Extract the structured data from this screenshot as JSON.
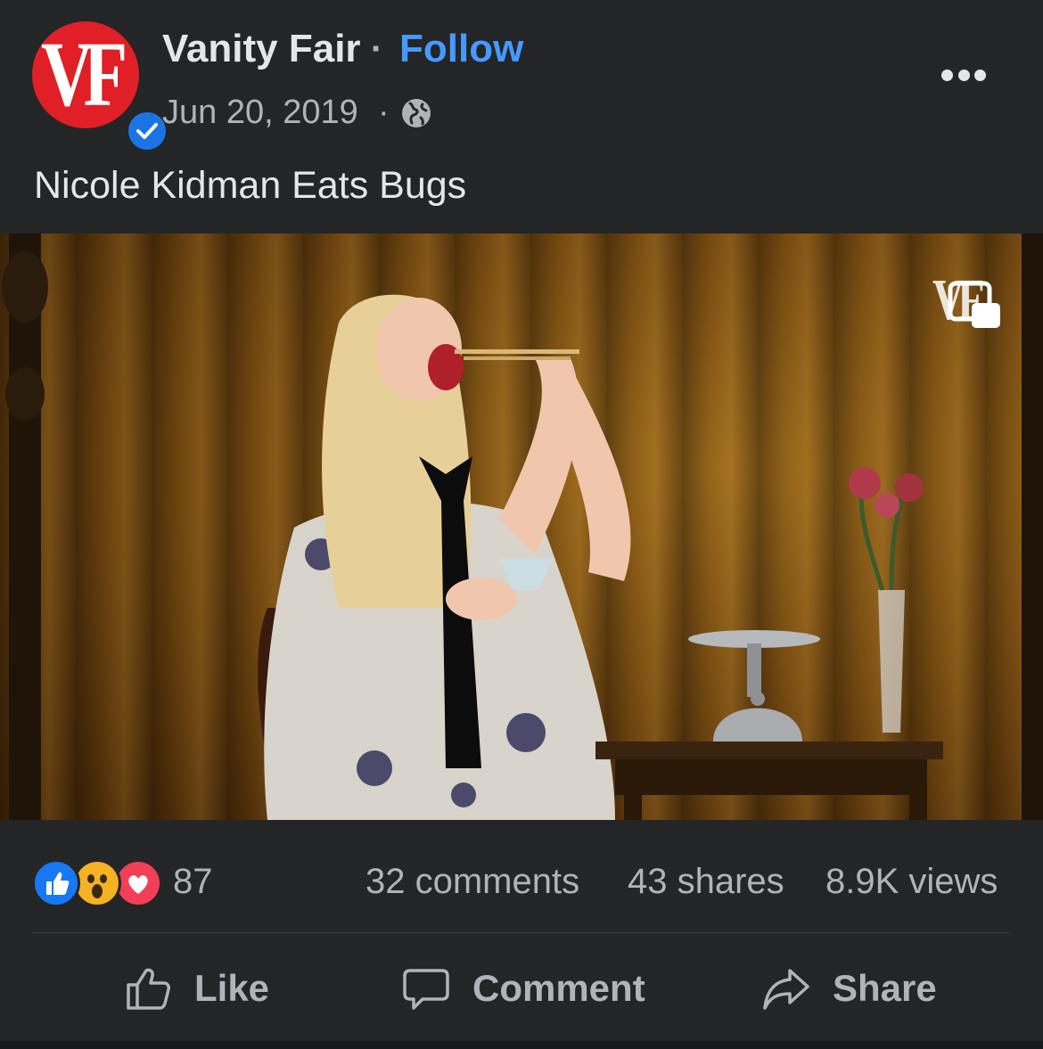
{
  "post": {
    "page_name": "Vanity Fair",
    "separator": "·",
    "follow_label": "Follow",
    "date": "Jun 20, 2019",
    "date_separator": "·",
    "audience_icon": "globe-icon",
    "avatar_text": "VF",
    "verified_icon": "verified-check-icon",
    "more_icon": "more-dots-icon",
    "caption": "Nicole Kidman Eats Bugs"
  },
  "video": {
    "watermark": "VF",
    "pip_icon": "picture-in-picture-icon"
  },
  "stats": {
    "reactions": [
      "like",
      "wow",
      "love"
    ],
    "reaction_count": "87",
    "comments": "32 comments",
    "shares": "43 shares",
    "views": "8.9K views"
  },
  "actions": {
    "like_label": "Like",
    "comment_label": "Comment",
    "share_label": "Share"
  },
  "colors": {
    "background": "#242526",
    "text": "#e4e6eb",
    "secondary_text": "#b0b3b8",
    "link": "#4599ff",
    "avatar_red": "#e01f26",
    "like_blue": "#1877f2",
    "love_red": "#f33e58",
    "wow_yellow": "#f7b125"
  }
}
